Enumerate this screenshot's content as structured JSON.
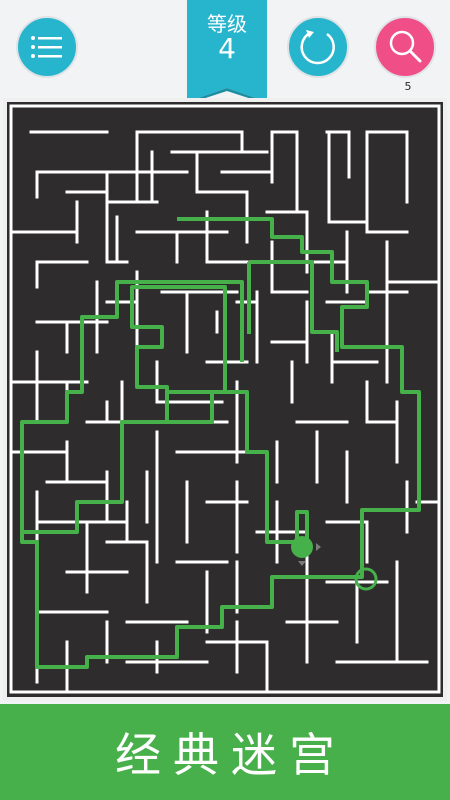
{
  "header": {
    "level_label": "等级",
    "level_number": "4",
    "hint_count": "5"
  },
  "banner": {
    "title": "经典迷宫"
  },
  "icons": {
    "menu": "menu-icon",
    "reset": "refresh-icon",
    "hint": "search-icon"
  },
  "colors": {
    "background": "#f1f3f4",
    "button_teal": "#27b5cd",
    "button_pink": "#ef4f86",
    "maze_background": "#2e2c2c",
    "maze_walls": "#ffffff",
    "solution_path": "#46b04a",
    "banner": "#47b04b"
  }
}
